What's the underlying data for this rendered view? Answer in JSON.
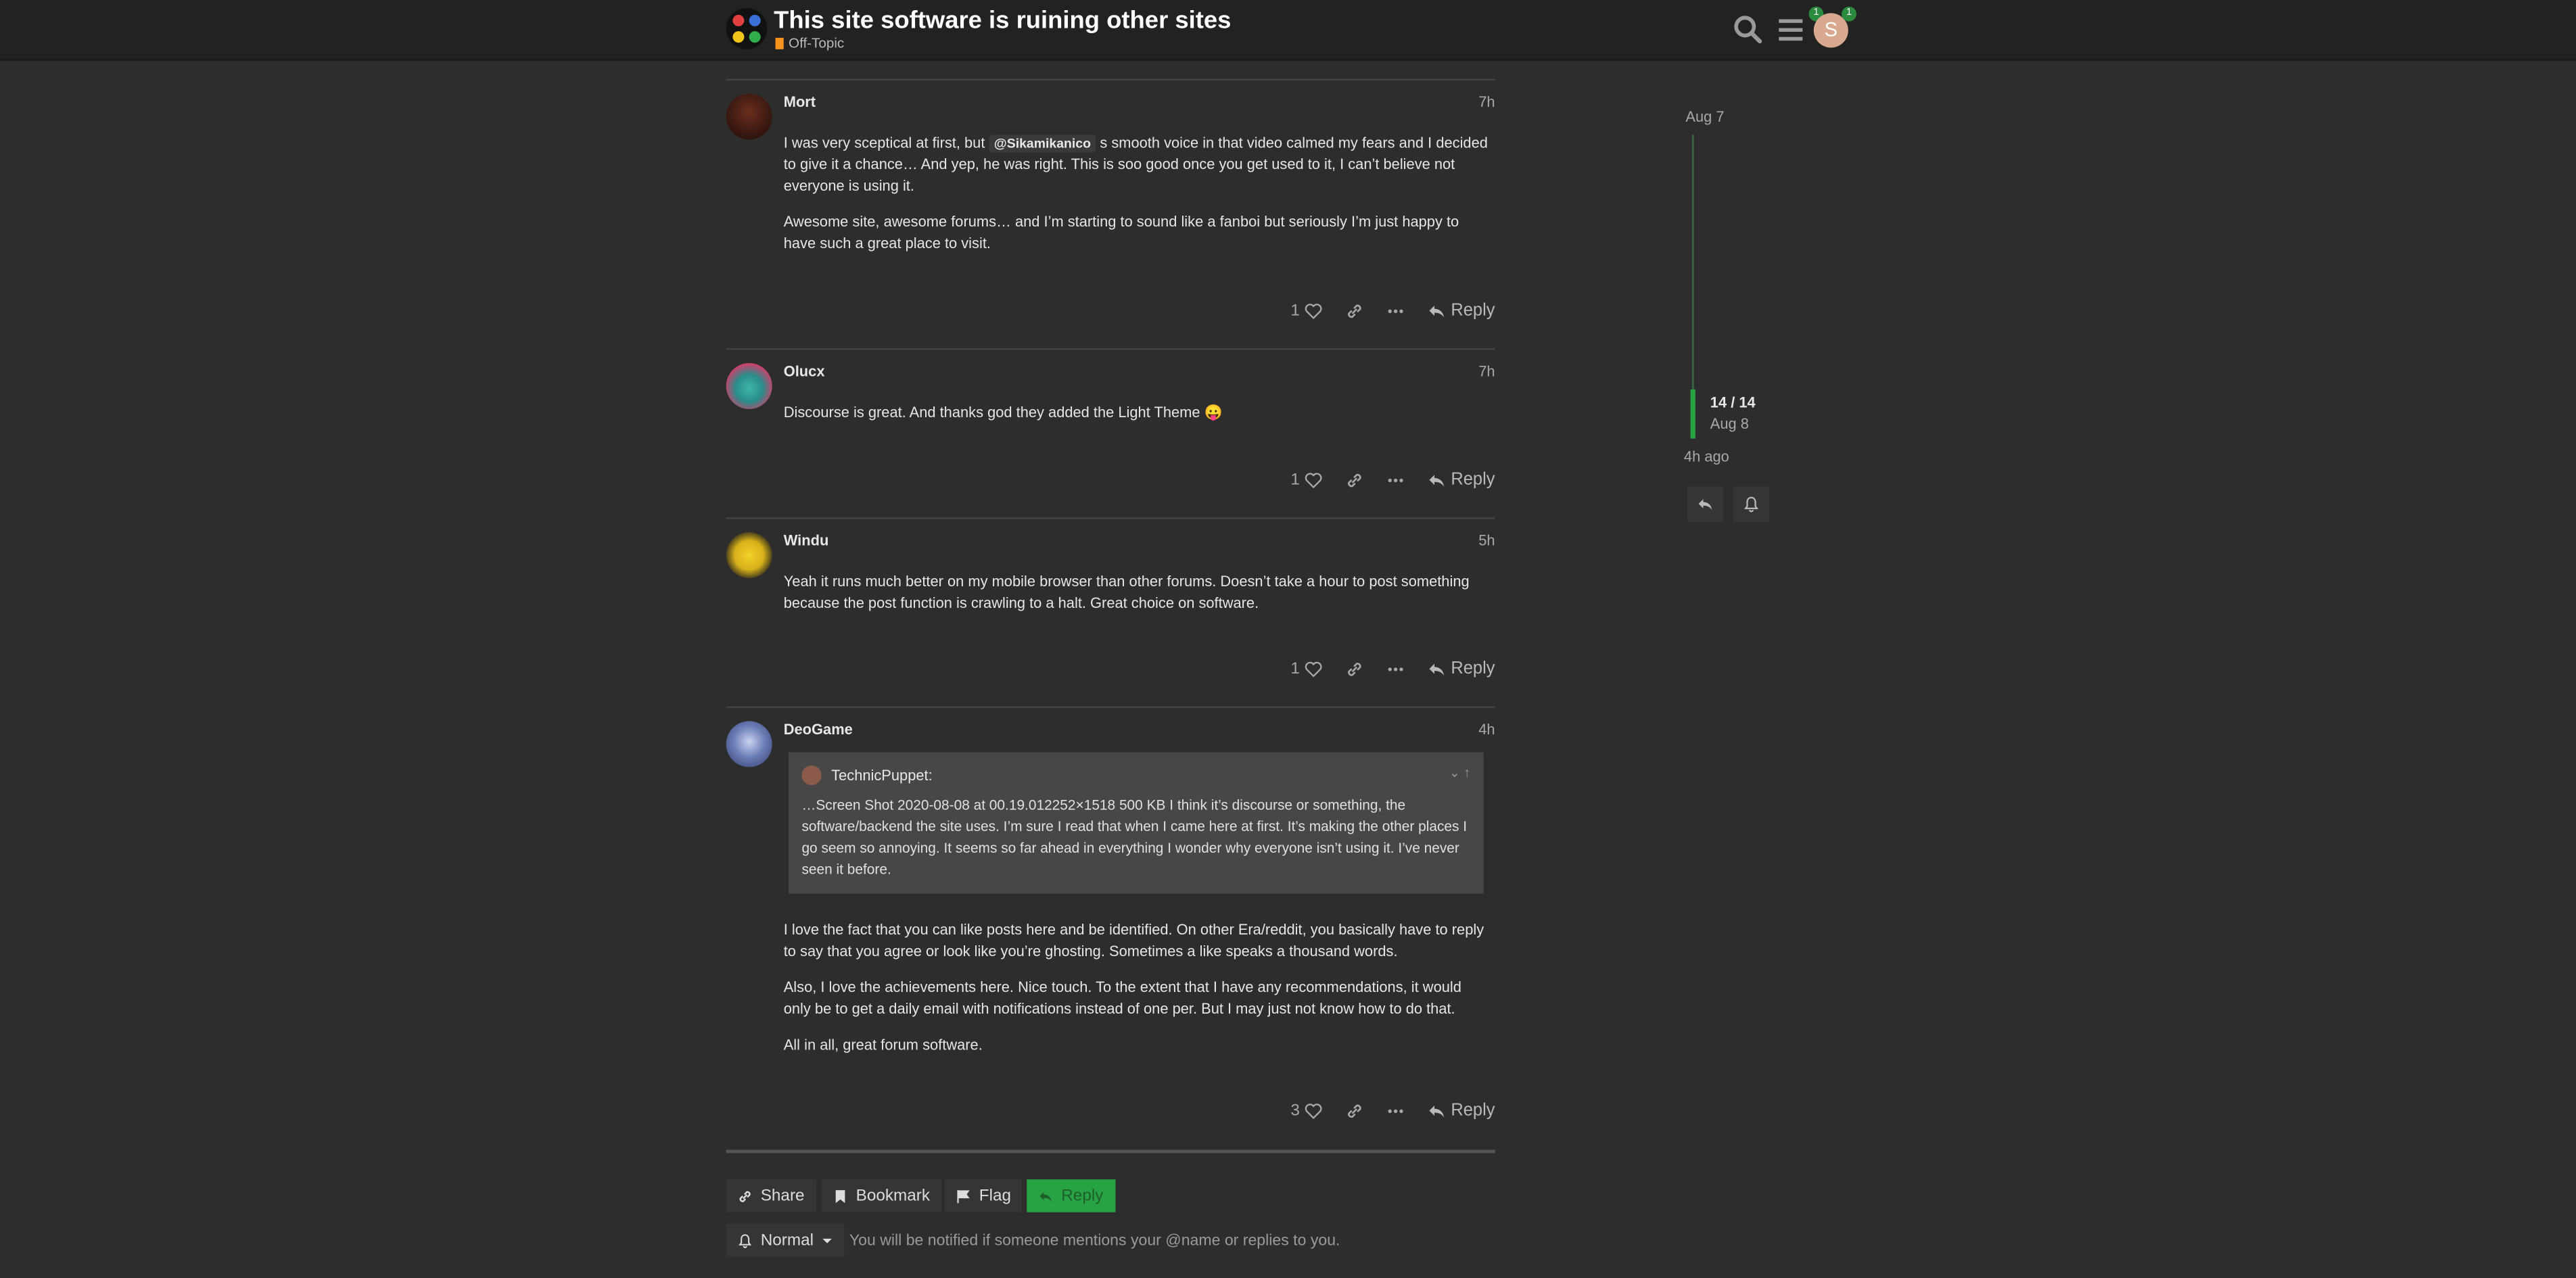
{
  "header": {
    "title": "This site software is ruining other sites",
    "category": "Off-Topic",
    "avatar_letter": "S",
    "notif_1": "1",
    "notif_2": "1"
  },
  "colors": {
    "accent": "#27a344",
    "category": "#f7941d",
    "background": "#2d2d2d",
    "header": "#222222"
  },
  "posts": [
    {
      "username": "Mort",
      "time": "7h",
      "p1_pre": "I was very sceptical at first, but ",
      "mention": "@Sikamikanico",
      "p1_post": " s smooth voice in that video calmed my fears and I decided to give it a chance… And yep, he was right. This is soo good once you get used to it, I can’t believe not everyone is using it.",
      "p2": "Awesome site, awesome forums… and I’m starting to sound like a fanboi but seriously I’m just happy to have such a great place to visit.",
      "likes": "1",
      "reply": "Reply"
    },
    {
      "username": "Olucx",
      "time": "7h",
      "p1": "Discourse is great. And thanks god they added the Light Theme",
      "emoji": "😛",
      "likes": "1",
      "reply": "Reply"
    },
    {
      "username": "Windu",
      "time": "5h",
      "p1": "Yeah it runs much better on my mobile browser than other forums. Doesn’t take a hour to post something because the post function is crawling to a halt. Great choice on software.",
      "likes": "1",
      "reply": "Reply"
    },
    {
      "username": "DeoGame",
      "time": "4h",
      "quote_author": "TechnicPuppet:",
      "quote_text": "…Screen Shot 2020-08-08 at 00.19.012252×1518 500 KB I think it’s discourse or something, the software/backend the site uses. I’m sure I read that when I came here at first. It’s making the other places I go seem so annoying. It seems so far ahead in everything I wonder why everyone isn’t using it. I’ve never seen it before.",
      "p1": "I love the fact that you can like posts here and be identified. On other Era/reddit, you basically have to reply to say that you agree or look like you’re ghosting. Sometimes a like speaks a thousand words.",
      "p2": "Also, I love the achievements here. Nice touch. To the extent that I have any recommendations, it would only be to get a daily email with notifications instead of one per. But I may just not know how to do that.",
      "p3": "All in all, great forum software.",
      "likes": "3",
      "reply": "Reply"
    }
  ],
  "footer": {
    "share": "Share",
    "bookmark": "Bookmark",
    "flag": "Flag",
    "reply": "Reply",
    "notify_level": "Normal",
    "notify_text": "You will be notified if someone mentions your @name or replies to you."
  },
  "timeline": {
    "start_date": "Aug 7",
    "position": "14 / 14",
    "end_date": "Aug 8",
    "last_activity": "4h ago"
  }
}
